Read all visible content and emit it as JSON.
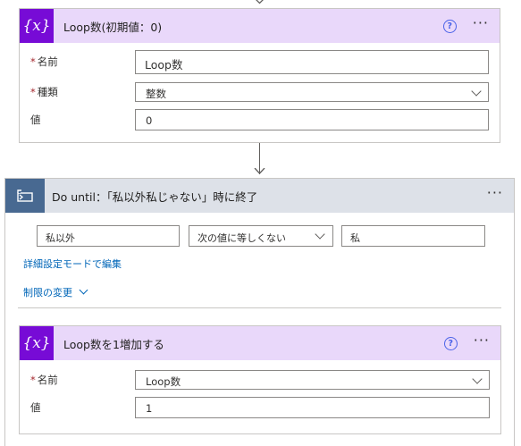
{
  "init_card": {
    "icon_text": "{x}",
    "title": "Loop数(初期値：0)",
    "help_icon": "?",
    "more_icon": "···",
    "fields": [
      {
        "label": "名前",
        "required": true,
        "value": "Loop数"
      },
      {
        "label": "種類",
        "required": true,
        "value": "整数",
        "dropdown": true
      },
      {
        "label": "値",
        "required": false,
        "value": "0"
      }
    ]
  },
  "do_until_card": {
    "icon": "loop-icon",
    "title": "Do until：「私以外私じゃない」時に終了",
    "more_icon": "···",
    "condition": {
      "left_value": "私以外",
      "operator": "次の値に等しくない",
      "right_value": "私"
    },
    "advanced_mode_link": "詳細設定モードで編集",
    "change_limits_link": "制限の変更"
  },
  "increment_card": {
    "icon_text": "{x}",
    "title": "Loop数を1増加する",
    "help_icon": "?",
    "more_icon": "···",
    "fields": [
      {
        "label": "名前",
        "required": true,
        "value": "Loop数",
        "dropdown": true
      },
      {
        "label": "値",
        "required": false,
        "value": "1"
      }
    ]
  },
  "colors": {
    "variable_accent": "#770bd6",
    "variable_header": "#e9d8fa",
    "control_accent": "#486991",
    "control_header": "#dde1e8",
    "link": "#0066b8",
    "required": "#a4262c"
  }
}
